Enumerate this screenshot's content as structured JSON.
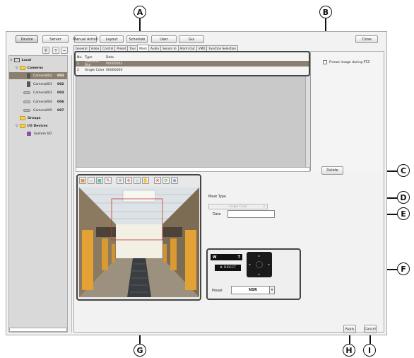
{
  "top_buttons": {
    "device": "Device",
    "server": "Server",
    "manual_action": "Manual Action",
    "layout": "Layout",
    "schedule": "Schedule",
    "user": "User",
    "gui": "Gui",
    "close": "Close"
  },
  "tabs": [
    "General",
    "Video",
    "Control",
    "Preset",
    "Tour",
    "Mask",
    "Audio",
    "Sensor In",
    "Alarm Out",
    "VMD",
    "Function Selection"
  ],
  "active_tab": "Mask",
  "tree": {
    "local": "Local",
    "cameras": "Cameras",
    "camera_rows": [
      {
        "name": "Camera002",
        "num": "003",
        "selected": true
      },
      {
        "name": "Camera001",
        "num": "002"
      },
      {
        "name": "Camera003",
        "num": "004"
      },
      {
        "name": "Camera004",
        "num": "006"
      },
      {
        "name": "Camera005",
        "num": "007"
      }
    ],
    "groups": "Groups",
    "io_devices": "I/O Devices",
    "system_io": "System I/O"
  },
  "mask_table": {
    "headers": [
      "No.",
      "Type",
      "Data"
    ],
    "rows": [
      {
        "no": "1",
        "type": "Gaussian Blur",
        "data": "00000003",
        "selected": true
      },
      {
        "no": "2",
        "type": "Single Color",
        "data": "00000000"
      }
    ]
  },
  "freeze_label": "Freeze image during PTZ",
  "delete_label": "Delete",
  "mask_type_label": "Mask Type",
  "mask_type_value": "Single Color",
  "data_label": "Data",
  "ptz": {
    "wide": "W",
    "tele": "T",
    "direct": "DIRECT",
    "preset_label": "Preset",
    "preset_value": "NSR"
  },
  "apply_label": "Apply",
  "cancel_label": "Cancel",
  "callouts": [
    "A",
    "B",
    "C",
    "D",
    "E",
    "F",
    "G",
    "H",
    "I"
  ]
}
